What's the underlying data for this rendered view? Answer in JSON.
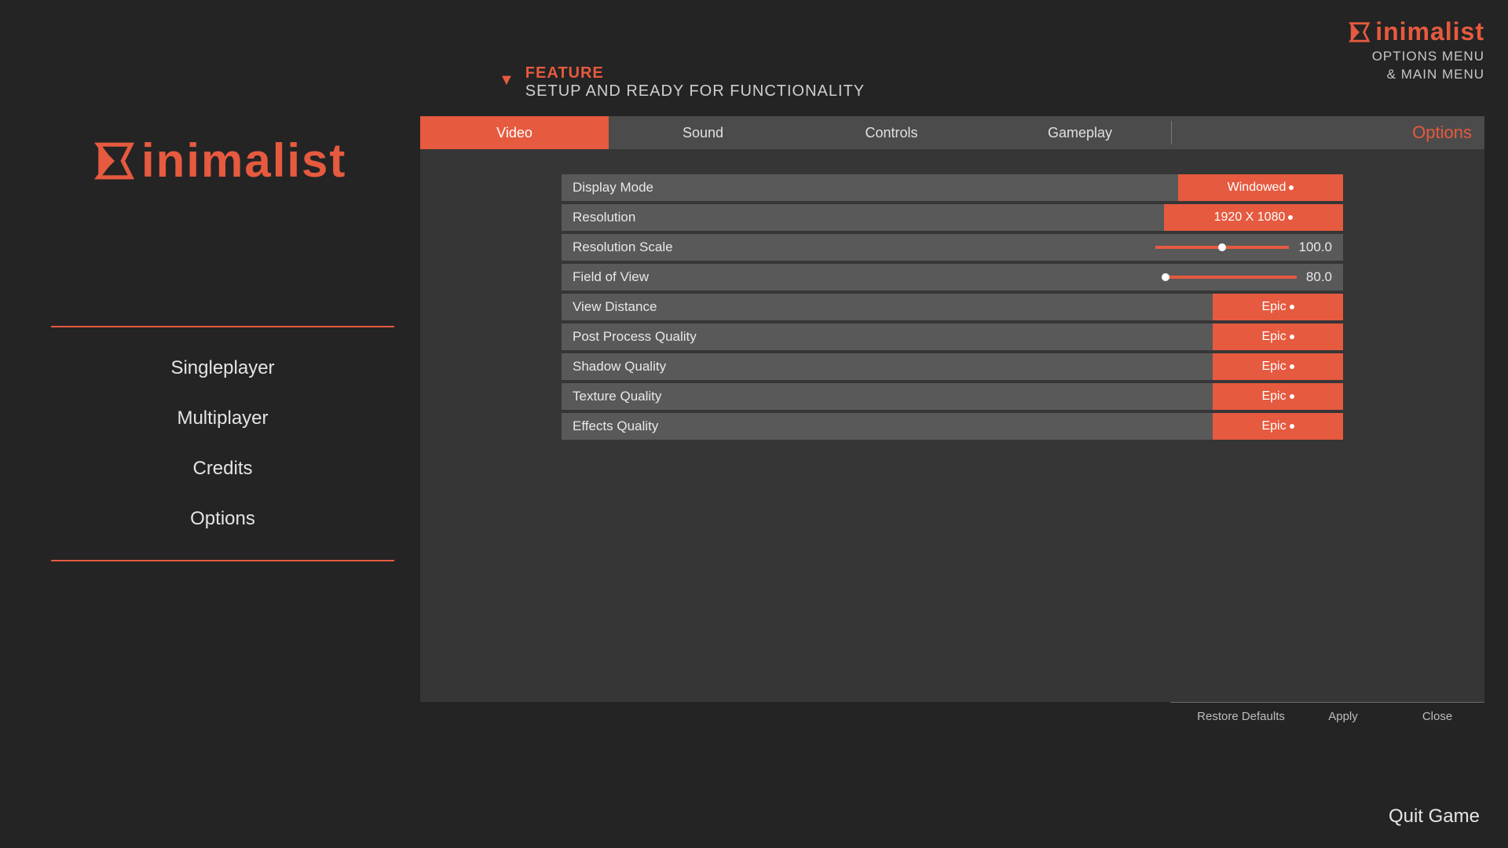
{
  "brand": {
    "title": "inimalist",
    "sub1": "OPTIONS MENU",
    "sub2": "& MAIN MENU"
  },
  "feature": {
    "title": "FEATURE",
    "subtitle": "SETUP AND READY FOR FUNCTIONALITY"
  },
  "sidebar": {
    "logo": "inimalist",
    "items": [
      "Singleplayer",
      "Multiplayer",
      "Credits",
      "Options"
    ]
  },
  "tabs": {
    "items": [
      "Video",
      "Sound",
      "Controls",
      "Gameplay"
    ],
    "activeIndex": 0,
    "optionsLabel": "Options"
  },
  "settings": {
    "displayMode": {
      "label": "Display Mode",
      "value": "Windowed"
    },
    "resolution": {
      "label": "Resolution",
      "value": "1920 X 1080"
    },
    "resolutionScale": {
      "label": "Resolution Scale",
      "value": "100.0",
      "knobPercent": 50
    },
    "fieldOfView": {
      "label": "Field of View",
      "value": "80.0",
      "knobPercent": 2
    },
    "viewDistance": {
      "label": "View Distance",
      "value": "Epic"
    },
    "postProcessQuality": {
      "label": "Post Process Quality",
      "value": "Epic"
    },
    "shadowQuality": {
      "label": "Shadow Quality",
      "value": "Epic"
    },
    "textureQuality": {
      "label": "Texture Quality",
      "value": "Epic"
    },
    "effectsQuality": {
      "label": "Effects Quality",
      "value": "Epic"
    }
  },
  "actions": {
    "restore": "Restore Defaults",
    "apply": "Apply",
    "close": "Close"
  },
  "quit": "Quit Game"
}
